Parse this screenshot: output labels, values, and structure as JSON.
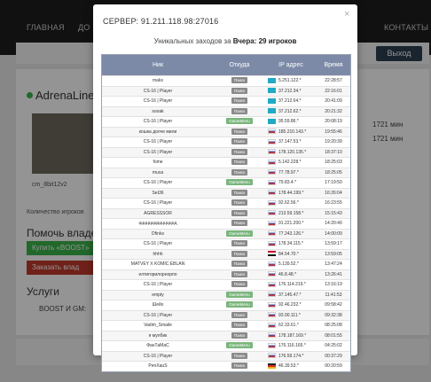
{
  "nav": {
    "home": "ГЛАВНАЯ",
    "add": "ДО",
    "contacts": "КОНТАКТЫ",
    "exit": "Выход"
  },
  "background": {
    "server_title": "AdrenaLine [Z",
    "thumb_caption": "cm_8bit12v2",
    "players_label": "Количество игроков",
    "help_title": "Помочь владе",
    "boost_button": "Купить «BOOST»",
    "remove_button": "Заказать влад",
    "services_title": "Услуги",
    "boost_label": "BOOST И GM:",
    "right_values": [
      "1721 мин",
      "1721 мин"
    ]
  },
  "modal": {
    "title": "СЕРВЕР: 91.211.118.98:27016",
    "subtitle_prefix": "Уникальных заходов за",
    "subtitle_period": "Вчера",
    "subtitle_count": ": 29 игроков",
    "close": "×",
    "columns": {
      "nick": "Ник",
      "source": "Откуда",
      "ip": "IP адрес",
      "time": "Время"
    },
    "rows": [
      {
        "nick": "maks",
        "source": "Поиск",
        "src_type": "search",
        "flag": "kz",
        "ip": "5.251.122.*",
        "time": "22:28:57"
      },
      {
        "nick": "CS-16 | Player",
        "source": "Поиск",
        "src_type": "search",
        "flag": "kz",
        "ip": "37.212.34.*",
        "time": "22:16:01"
      },
      {
        "nick": "CS-16 | Player",
        "source": "Поиск",
        "src_type": "search",
        "flag": "kz",
        "ip": "37.212.64.*",
        "time": "20:41:09"
      },
      {
        "nick": "sooak",
        "source": "Поиск",
        "src_type": "search",
        "flag": "kz",
        "ip": "37.212.62.*",
        "time": "20:21:32"
      },
      {
        "nick": "CS-16 | Player",
        "source": "GameMenu",
        "src_type": "gm",
        "flag": "kz",
        "ip": "95.59.86.*",
        "time": "20:08:19"
      },
      {
        "nick": "кошка долче мили",
        "source": "Поиск",
        "src_type": "search",
        "flag": "ru",
        "ip": "185.210.143.*",
        "time": "19:55:46"
      },
      {
        "nick": "CS-16 | Player",
        "source": "Поиск",
        "src_type": "search",
        "flag": "ru",
        "ip": "37.147.53.*",
        "time": "19:20:39"
      },
      {
        "nick": "CS-16 | Player",
        "source": "Поиск",
        "src_type": "search",
        "flag": "ru",
        "ip": "178.120.135.*",
        "time": "18:37:10"
      },
      {
        "nick": "fome",
        "source": "Поиск",
        "src_type": "search",
        "flag": "ru",
        "ip": "5.142.228.*",
        "time": "18:25:03"
      },
      {
        "nick": "muxa",
        "source": "Поиск",
        "src_type": "search",
        "flag": "ru",
        "ip": "77.78.97.*",
        "time": "18:25:05"
      },
      {
        "nick": "CS-16 | Player",
        "source": "GameMenu",
        "src_type": "gm",
        "flag": "ru",
        "ip": "79.83.4.*",
        "time": "17:19:50"
      },
      {
        "nick": "Set36",
        "source": "Поиск",
        "src_type": "search",
        "flag": "ru",
        "ip": "178.44.199.*",
        "time": "16:26:04"
      },
      {
        "nick": "CS-16 | Player",
        "source": "Поиск",
        "src_type": "search",
        "flag": "ru",
        "ip": "92.62.56.*",
        "time": "16:23:55"
      },
      {
        "nick": "AGRESSSOR",
        "source": "Поиск",
        "src_type": "search",
        "flag": "ru",
        "ip": "213.59.158.*",
        "time": "15:15:43"
      },
      {
        "nick": "ццццццццццццццц",
        "source": "Поиск",
        "src_type": "search",
        "flag": "ru",
        "ip": "91.221.200.*",
        "time": "14:20:40"
      },
      {
        "nick": "Dfinks",
        "source": "GameMenu",
        "src_type": "gm",
        "flag": "ru",
        "ip": "77.243.126.*",
        "time": "14:00:09"
      },
      {
        "nick": "CS-16 | Player",
        "source": "Поиск",
        "src_type": "search",
        "flag": "ru",
        "ip": "178.34.115.*",
        "time": "13:59:17"
      },
      {
        "nick": "hhhh",
        "source": "Поиск",
        "src_type": "search",
        "flag": "eg",
        "ip": "84.54.70.*",
        "time": "13:59:05"
      },
      {
        "nick": "MATVEY X KOMIC EBLAN",
        "source": "Поиск",
        "src_type": "search",
        "flag": "ru",
        "ip": "5.139.52.*",
        "time": "13:47:24"
      },
      {
        "nick": "елтигорилорнорпо",
        "source": "Поиск",
        "src_type": "search",
        "flag": "ru",
        "ip": "46.8.48.*",
        "time": "13:26:41"
      },
      {
        "nick": "CS-16 | Player",
        "source": "Поиск",
        "src_type": "search",
        "flag": "ru",
        "ip": "176.114.219.*",
        "time": "13:16:19"
      },
      {
        "nick": "empty",
        "source": "GameMenu",
        "src_type": "gm",
        "flag": "ru",
        "ip": "37.145.47.*",
        "time": "11:41:53"
      },
      {
        "nick": "Шейх",
        "source": "GameMenu",
        "src_type": "gm",
        "flag": "ru",
        "ip": "92.46.232.*",
        "time": "09:58:42"
      },
      {
        "nick": "CS-16 | Player",
        "source": "Поиск",
        "src_type": "search",
        "flag": "ru",
        "ip": "93.90.111.*",
        "time": "09:32:38"
      },
      {
        "nick": "Vadim_Smaile",
        "source": "Поиск",
        "src_type": "search",
        "flag": "ru",
        "ip": "62.33.61.*",
        "time": "08:25:08"
      },
      {
        "nick": "я мулбик",
        "source": "Поиск",
        "src_type": "search",
        "flag": "ru",
        "ip": "178.187.169.*",
        "time": "08:01:55"
      },
      {
        "nick": "ФанТаМаС",
        "source": "GameMenu",
        "src_type": "gm",
        "flag": "ru",
        "ip": "176.116.165.*",
        "time": "04:25:02"
      },
      {
        "nick": "CS-16 | Player",
        "source": "Поиск",
        "src_type": "search",
        "flag": "ru",
        "ip": "176.59.174.*",
        "time": "00:37:29"
      },
      {
        "nick": "PenXauS",
        "source": "Поиск",
        "src_type": "search",
        "flag": "de",
        "ip": "46.39.53.*",
        "time": "00:20:59"
      }
    ]
  }
}
